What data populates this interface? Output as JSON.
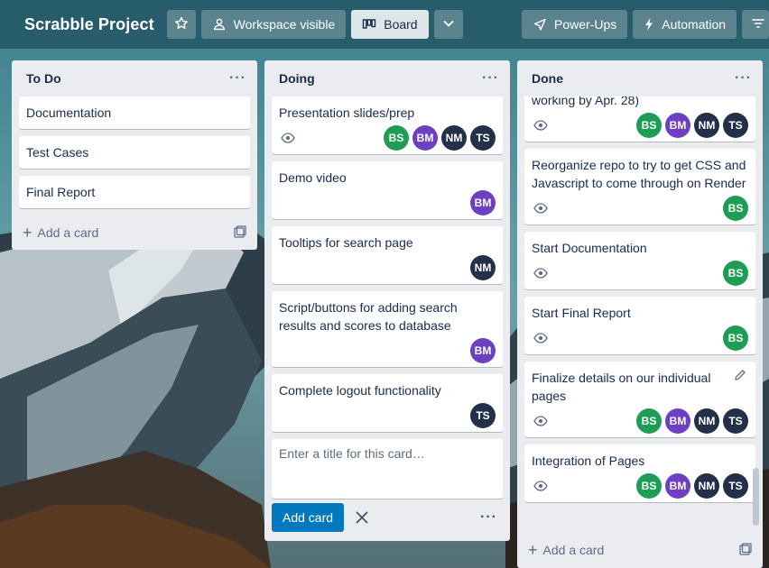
{
  "header": {
    "board_title": "Scrabble Project",
    "star_icon": "star-icon",
    "visibility_label": "Workspace visible",
    "view_label": "Board",
    "powerups_label": "Power-Ups",
    "automation_label": "Automation"
  },
  "colors": {
    "list_bg": "#ebecf0",
    "primary": "#0079bf",
    "avatar_bs": "#1f9d55",
    "avatar_bm": "#6d3fc1",
    "avatar_nm": "#22304a",
    "avatar_ts": "#22304a"
  },
  "lists": {
    "todo": {
      "title": "To Do",
      "cards": [
        "Documentation",
        "Test Cases",
        "Final Report"
      ],
      "add_label": "Add a card"
    },
    "doing": {
      "title": "Doing",
      "cards": [
        {
          "title": "Presentation slides/prep",
          "members": [
            "BS",
            "BM",
            "NM",
            "TS"
          ]
        },
        {
          "title": "Demo video",
          "members": [
            "BM"
          ]
        },
        {
          "title": "Tooltips for search page",
          "members": [
            "NM"
          ]
        },
        {
          "title": "Script/buttons for adding search results and scores to database",
          "members": [
            "BM"
          ]
        },
        {
          "title": "Complete logout functionality",
          "members": [
            "TS"
          ]
        }
      ],
      "composer_placeholder": "Enter a title for this card…",
      "add_button": "Add card"
    },
    "done": {
      "title": "Done",
      "cards": [
        {
          "title": "working by Apr. 28)",
          "members": [
            "BS",
            "BM",
            "NM",
            "TS"
          ]
        },
        {
          "title": "Reorganize repo to try to get CSS and Javascript to come through on Render",
          "members": [
            "BS"
          ]
        },
        {
          "title": "Start Documentation",
          "members": [
            "BS"
          ]
        },
        {
          "title": "Start Final Report",
          "members": [
            "BS"
          ]
        },
        {
          "title": "Finalize details on our individual pages",
          "members": [
            "BS",
            "BM",
            "NM",
            "TS"
          ]
        },
        {
          "title": "Integration of Pages",
          "members": [
            "BS",
            "BM",
            "NM",
            "TS"
          ]
        }
      ],
      "add_label": "Add a card"
    }
  }
}
